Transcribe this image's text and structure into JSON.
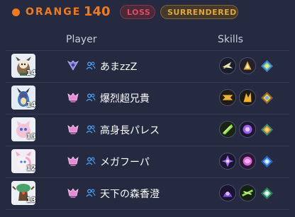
{
  "header": {
    "team": "ORANGE",
    "score": "140",
    "result": "LOSS",
    "status": "SURRENDERED",
    "team_color": "#f07a1c",
    "loss_color": "#e24b60",
    "surrendered_color": "#e0a73a"
  },
  "columns": {
    "player": "Player",
    "skills": "Skills"
  },
  "players": [
    {
      "level": "14",
      "name": "あまzzZ",
      "rank_icon": "ultra-rank-icon",
      "pokemon_icon": "decidueye-avatar",
      "skills": [
        "skill-icon-1",
        "skill-icon-2"
      ],
      "held_item": "held-item-icon"
    },
    {
      "level": "14",
      "name": "爆烈超兄貴",
      "rank_icon": "master-rank-icon",
      "pokemon_icon": "lucario-avatar",
      "skills": [
        "skill-icon-1",
        "skill-icon-2"
      ],
      "held_item": "held-item-icon"
    },
    {
      "level": "13",
      "name": "高身長パレス",
      "rank_icon": "master-rank-icon",
      "pokemon_icon": "mew-avatar",
      "skills": [
        "skill-icon-1",
        "skill-icon-2"
      ],
      "held_item": "held-item-icon"
    },
    {
      "level": "12",
      "name": "メガフーパ",
      "rank_icon": "master-rank-icon",
      "pokemon_icon": "sylveon-avatar",
      "skills": [
        "skill-icon-1",
        "skill-icon-2"
      ],
      "held_item": "held-item-icon"
    },
    {
      "level": "13",
      "name": "天下の森香澄",
      "rank_icon": "master-rank-icon",
      "pokemon_icon": "trevenant-avatar",
      "skills": [
        "skill-icon-1",
        "skill-icon-2"
      ],
      "held_item": "held-item-icon"
    }
  ]
}
